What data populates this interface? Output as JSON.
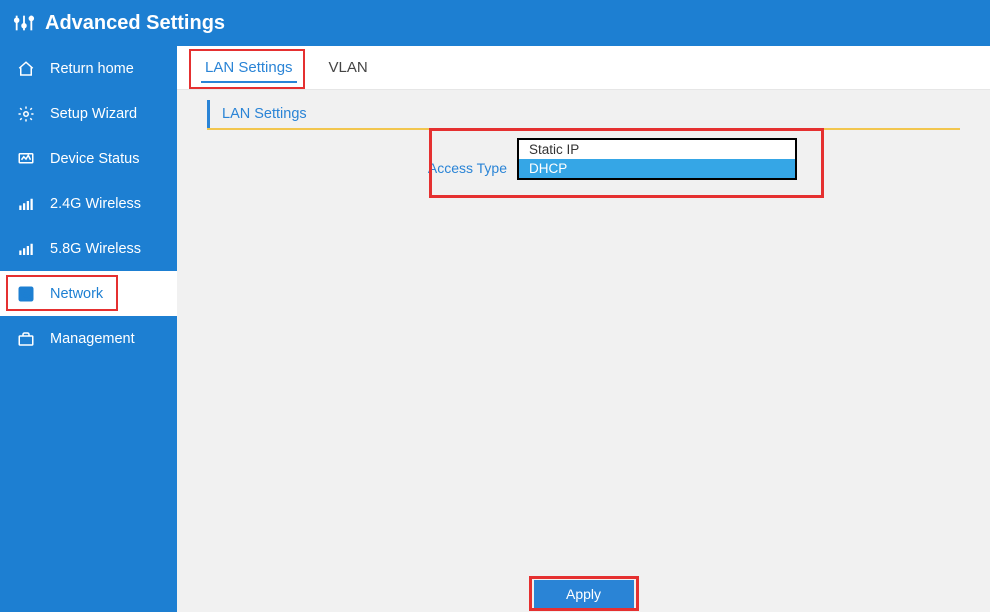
{
  "header": {
    "title": "Advanced Settings"
  },
  "sidebar": {
    "items": [
      {
        "label": "Return home"
      },
      {
        "label": "Setup Wizard"
      },
      {
        "label": "Device Status"
      },
      {
        "label": "2.4G Wireless"
      },
      {
        "label": "5.8G Wireless"
      },
      {
        "label": "Network"
      },
      {
        "label": "Management"
      }
    ]
  },
  "tabs": [
    {
      "label": "LAN Settings"
    },
    {
      "label": "VLAN"
    }
  ],
  "section": {
    "title": "LAN Settings"
  },
  "form": {
    "access_type_label": "Access Type",
    "access_type_options": [
      {
        "label": "Static IP"
      },
      {
        "label": "DHCP"
      }
    ]
  },
  "footer": {
    "apply_label": "Apply"
  }
}
